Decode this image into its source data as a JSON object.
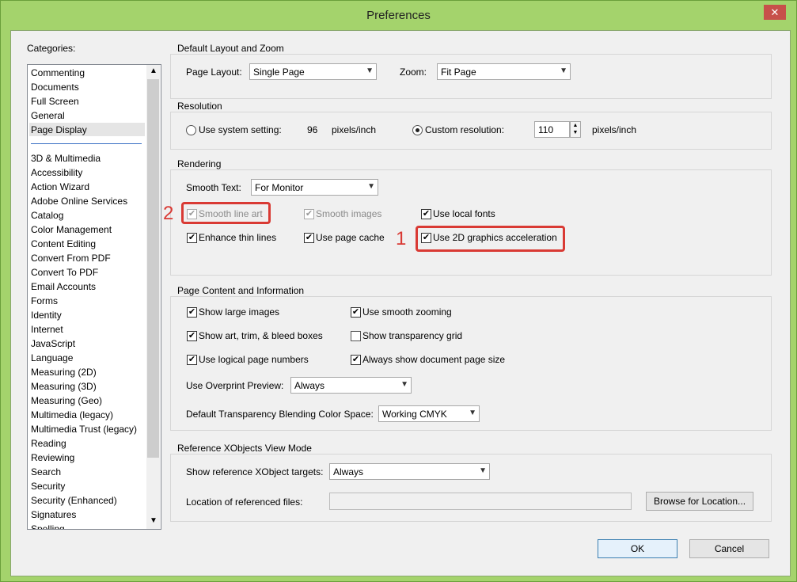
{
  "window": {
    "title": "Preferences",
    "close_glyph": "✕"
  },
  "categories": {
    "label": "Categories:",
    "top_items": [
      "Commenting",
      "Documents",
      "Full Screen",
      "General",
      "Page Display"
    ],
    "selected": "Page Display",
    "items": [
      "3D & Multimedia",
      "Accessibility",
      "Action Wizard",
      "Adobe Online Services",
      "Catalog",
      "Color Management",
      "Content Editing",
      "Convert From PDF",
      "Convert To PDF",
      "Email Accounts",
      "Forms",
      "Identity",
      "Internet",
      "JavaScript",
      "Language",
      "Measuring (2D)",
      "Measuring (3D)",
      "Measuring (Geo)",
      "Multimedia (legacy)",
      "Multimedia Trust (legacy)",
      "Reading",
      "Reviewing",
      "Search",
      "Security",
      "Security (Enhanced)",
      "Signatures",
      "Spelling"
    ]
  },
  "layout_zoom": {
    "title": "Default Layout and Zoom",
    "page_layout_label": "Page Layout:",
    "page_layout_value": "Single Page",
    "zoom_label": "Zoom:",
    "zoom_value": "Fit Page"
  },
  "resolution": {
    "title": "Resolution",
    "system_label": "Use system setting:",
    "system_value": "96",
    "system_unit": "pixels/inch",
    "custom_label": "Custom resolution:",
    "custom_value": "110",
    "custom_unit": "pixels/inch",
    "selected": "custom"
  },
  "rendering": {
    "title": "Rendering",
    "smooth_text_label": "Smooth Text:",
    "smooth_text_value": "For Monitor",
    "smooth_line_art": "Smooth line art",
    "smooth_images": "Smooth images",
    "use_local_fonts": "Use local fonts",
    "enhance_thin_lines": "Enhance thin lines",
    "use_page_cache": "Use page cache",
    "use_2d_acceleration": "Use 2D graphics acceleration",
    "check": "✔"
  },
  "annotations": {
    "mark1": "1",
    "mark2": "2"
  },
  "page_content": {
    "title": "Page Content and Information",
    "show_large_images": "Show large images",
    "use_smooth_zooming": "Use smooth zooming",
    "show_art_boxes": "Show art, trim, & bleed boxes",
    "show_transparency_grid": "Show transparency grid",
    "use_logical_page_numbers": "Use logical page numbers",
    "always_show_page_size": "Always show document page size",
    "overprint_label": "Use Overprint Preview:",
    "overprint_value": "Always",
    "blending_label": "Default Transparency Blending Color Space:",
    "blending_value": "Working CMYK"
  },
  "xobjects": {
    "title": "Reference XObjects View Mode",
    "targets_label": "Show reference XObject targets:",
    "targets_value": "Always",
    "location_label": "Location of referenced files:",
    "location_value": "",
    "browse_label": "Browse for Location..."
  },
  "footer": {
    "ok_label": "OK",
    "cancel_label": "Cancel"
  },
  "icons": {
    "dropdown": "chevron-down-icon",
    "scroll_up": "chevron-up-icon",
    "scroll_down": "chevron-down-icon"
  },
  "colors": {
    "frame": "#a4d36c",
    "highlight": "#d93a34",
    "client": "#f0f0f0"
  }
}
